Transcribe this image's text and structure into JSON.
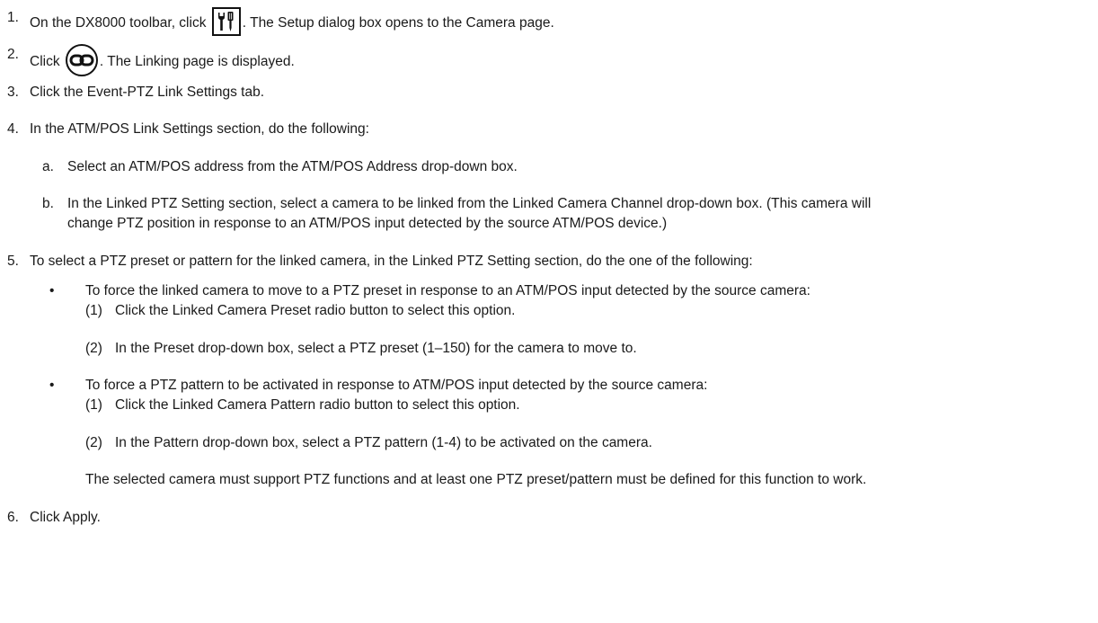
{
  "steps": [
    {
      "num": "1.",
      "pre": "On the DX8000 toolbar, click ",
      "icon": "setup-tools-icon",
      "post": ". The Setup dialog box opens to the Camera page."
    },
    {
      "num": "2.",
      "pre": "Click ",
      "icon": "link-chain-icon",
      "post": ". The Linking page is displayed."
    },
    {
      "num": "3.",
      "text": "Click the Event-PTZ Link Settings tab."
    },
    {
      "num": "4.",
      "text": "In the ATM/POS Link Settings section, do the following:"
    },
    {
      "num": "5.",
      "text": "To select a PTZ preset or pattern for the linked camera, in the Linked PTZ Setting section, do the one of the following:"
    },
    {
      "num": "6.",
      "text": "Click Apply."
    }
  ],
  "step4_sub": [
    {
      "letter": "a.",
      "lines": [
        "Select an ATM/POS address from the ATM/POS Address drop-down box."
      ]
    },
    {
      "letter": "b.",
      "lines": [
        "In the Linked PTZ Setting section, select a camera to be linked from the Linked Camera Channel drop-down box. (This camera will",
        "change PTZ position in response to an ATM/POS input detected by the source ATM/POS device.)"
      ]
    }
  ],
  "step5_bullets": [
    {
      "text": "To force the linked camera to move to a PTZ preset in response to an ATM/POS input detected by the source camera:",
      "items": [
        {
          "num": "(1)",
          "text": "Click the Linked Camera Preset radio button to select this option."
        },
        {
          "num": "(2)",
          "text": "In the Preset drop-down box, select a PTZ preset (1–150) for the camera to move to."
        }
      ]
    },
    {
      "text": "To force a PTZ pattern to be activated in response to ATM/POS input detected by the source camera:",
      "items": [
        {
          "num": "(1)",
          "text": "Click the Linked Camera Pattern radio button to select this option."
        },
        {
          "num": "(2)",
          "text": "In the Pattern drop-down box, select a PTZ pattern (1-4) to be activated on the camera."
        }
      ]
    }
  ],
  "step5_note": "The selected camera must support PTZ functions and at least one PTZ preset/pattern must be defined for this function to work."
}
